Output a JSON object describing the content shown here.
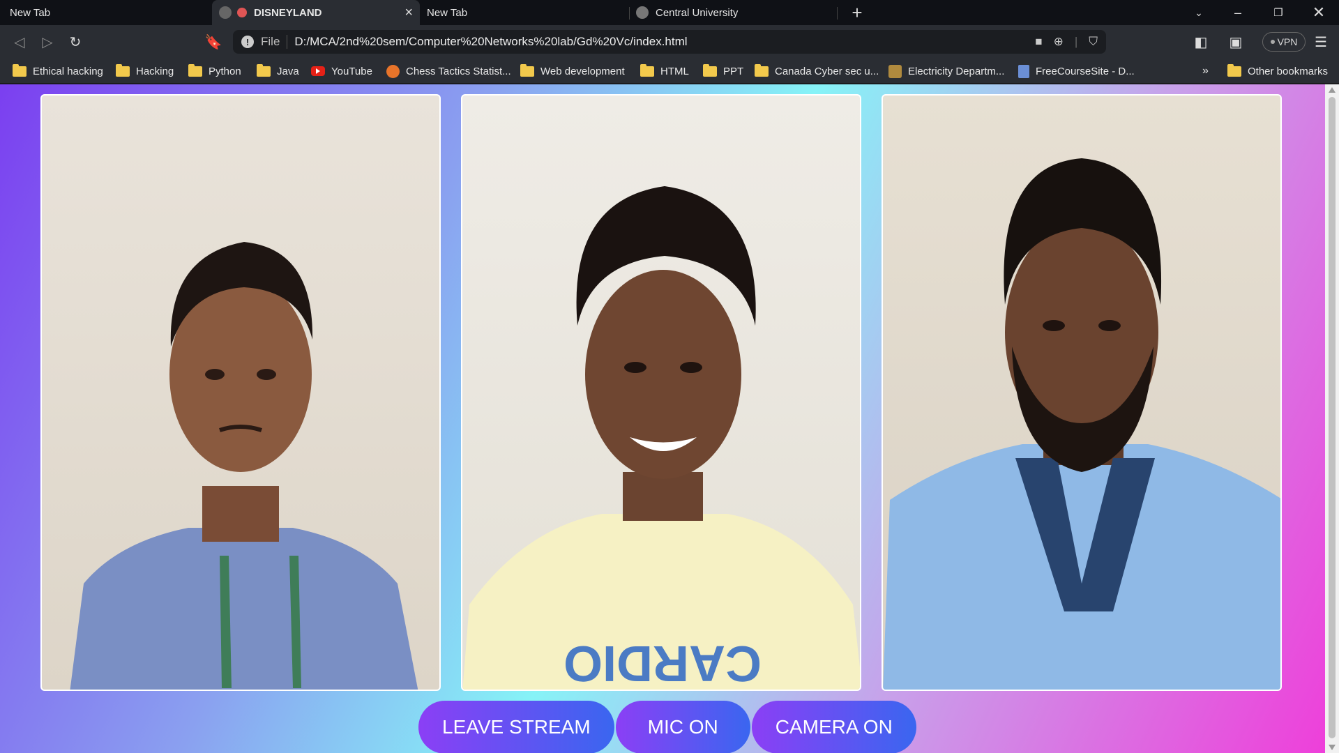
{
  "browser": {
    "tabs": [
      {
        "label": "New Tab",
        "active": false
      },
      {
        "label": "DISNEYLAND",
        "active": true
      },
      {
        "label": "New Tab",
        "active": false
      },
      {
        "label": "Central University",
        "active": false
      }
    ],
    "url_scheme": "File",
    "url": "D:/MCA/2nd%20sem/Computer%20Networks%20lab/Gd%20Vc/index.html",
    "vpn_label": "VPN",
    "bookmarks": [
      {
        "label": "Ethical hacking",
        "icon": "folder-icon"
      },
      {
        "label": "Hacking",
        "icon": "folder-icon"
      },
      {
        "label": "Python",
        "icon": "folder-icon"
      },
      {
        "label": "Java",
        "icon": "folder-icon"
      },
      {
        "label": "YouTube",
        "icon": "youtube-icon"
      },
      {
        "label": "Chess Tactics Statist...",
        "icon": "chess-icon"
      },
      {
        "label": "Web development",
        "icon": "folder-icon"
      },
      {
        "label": "HTML",
        "icon": "folder-icon"
      },
      {
        "label": "PPT",
        "icon": "folder-icon"
      },
      {
        "label": "Canada Cyber sec u...",
        "icon": "folder-icon"
      },
      {
        "label": "Electricity Departm...",
        "icon": "emblem-icon"
      },
      {
        "label": "FreeCourseSite - D...",
        "icon": "site-icon"
      }
    ],
    "overflow_label": "»",
    "other_bookmarks": "Other bookmarks"
  },
  "page": {
    "videos": [
      {
        "name": "video-tile-1",
        "shirt_color": "#7a8fc4"
      },
      {
        "name": "video-tile-2",
        "shirt_color": "#f6f1c4"
      },
      {
        "name": "video-tile-3",
        "shirt_color": "#8fb9e6"
      }
    ],
    "controls": {
      "leave_label": "LEAVE STREAM",
      "mic_label": "MIC ON",
      "camera_label": "CAMERA ON"
    }
  }
}
